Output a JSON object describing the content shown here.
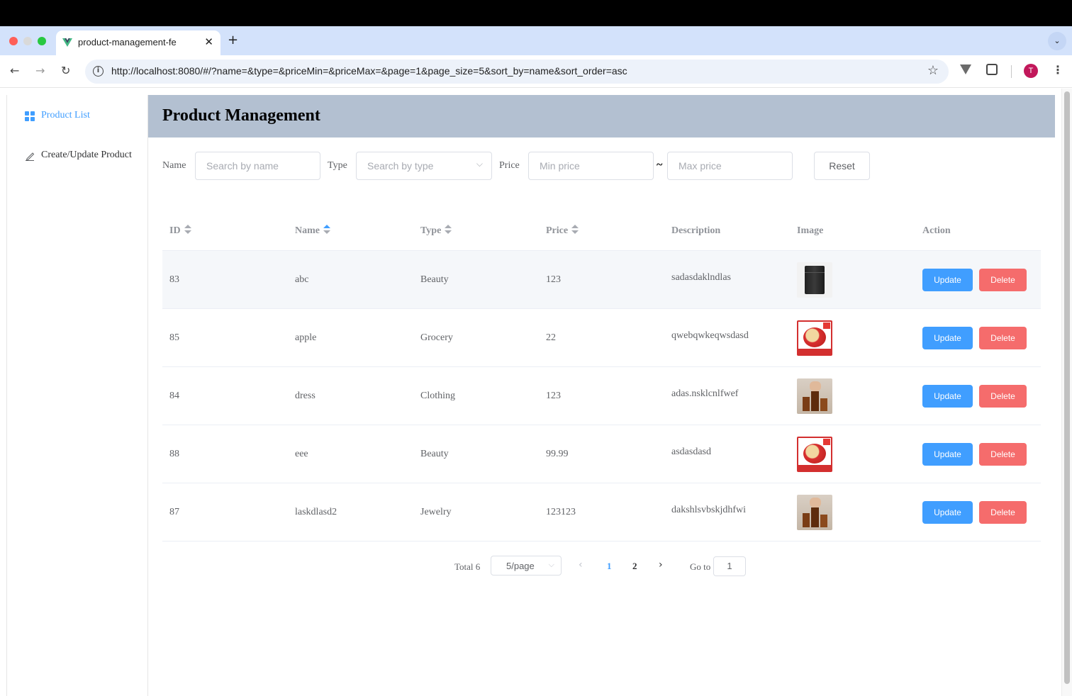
{
  "browser": {
    "tab_title": "product-management-fe",
    "tab_close": "✕",
    "new_tab": "+",
    "url": "http://localhost:8080/#/?name=&type=&priceMin=&priceMax=&page=1&page_size=5&sort_by=name&sort_order=asc",
    "avatar_letter": "T"
  },
  "sidebar": {
    "items": [
      {
        "label": "Product List",
        "icon": "grid-icon",
        "active": true
      },
      {
        "label": "Create/Update Product",
        "icon": "edit-icon",
        "active": false
      }
    ]
  },
  "header": {
    "title": "Product Management"
  },
  "filters": {
    "name_label": "Name",
    "name_placeholder": "Search by name",
    "type_label": "Type",
    "type_placeholder": "Search by type",
    "price_label": "Price",
    "min_placeholder": "Min price",
    "separator": "~",
    "max_placeholder": "Max price",
    "reset_label": "Reset"
  },
  "table": {
    "columns": [
      "ID",
      "Name",
      "Type",
      "Price",
      "Description",
      "Image",
      "Action"
    ],
    "sort": {
      "column": "Name",
      "order": "asc"
    },
    "update_label": "Update",
    "delete_label": "Delete",
    "rows": [
      {
        "id": "83",
        "name": "abc",
        "type": "Beauty",
        "price": "123",
        "description": "sadasdaklndlas",
        "image": "fridge"
      },
      {
        "id": "85",
        "name": "apple",
        "type": "Grocery",
        "price": "22",
        "description": "qwebqwkeqwsdasd",
        "image": "apple"
      },
      {
        "id": "84",
        "name": "dress",
        "type": "Clothing",
        "price": "123",
        "description": "adas.nsklcnlfwef",
        "image": "perfume"
      },
      {
        "id": "88",
        "name": "eee",
        "type": "Beauty",
        "price": "99.99",
        "description": "asdasdasd",
        "image": "apple"
      },
      {
        "id": "87",
        "name": "laskdlasd2",
        "type": "Jewelry",
        "price": "123123",
        "description": "dakshlsvbskjdhfwi",
        "image": "perfume"
      }
    ]
  },
  "pagination": {
    "total_text": "Total 6",
    "page_size": "5/page",
    "pages": [
      "1",
      "2"
    ],
    "current_page": "1",
    "goto_label": "Go to",
    "goto_value": "1"
  },
  "colors": {
    "primary": "#409eff",
    "danger": "#f56c6c",
    "header_bg": "#b3c0d1"
  }
}
